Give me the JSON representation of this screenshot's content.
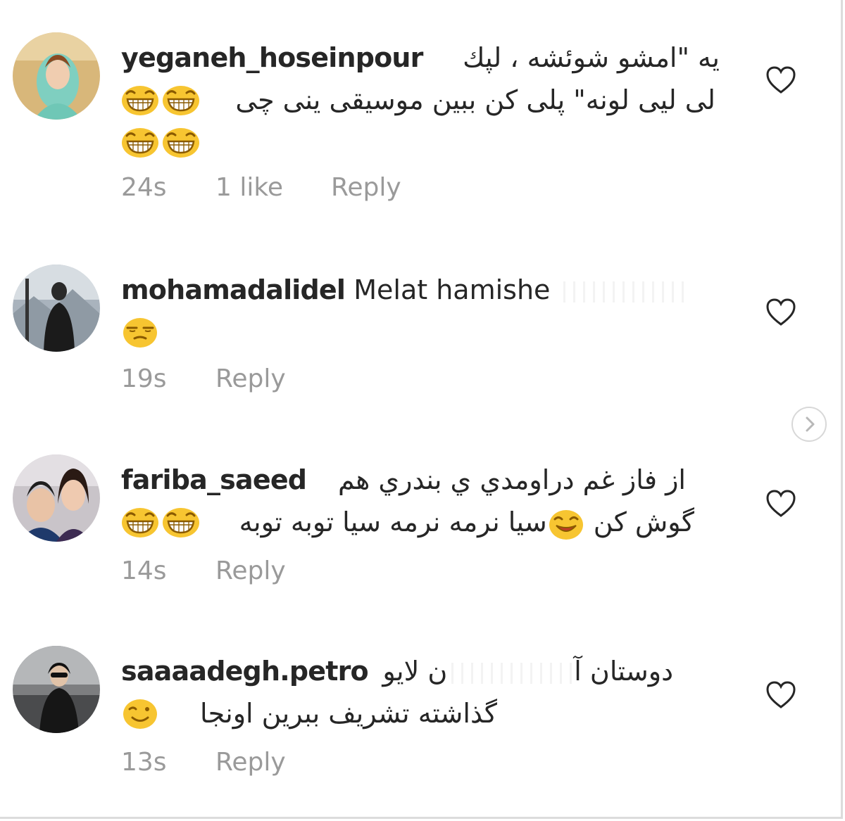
{
  "comments": [
    {
      "username": "yeganeh_hoseinpour",
      "line1_rtl": "يه \"امشو شوئشه ، لپك",
      "line2_rtl": "لی لیی لونه\" پلی کن ببین موسیقی ینی چی",
      "time": "24s",
      "likes": "1 like",
      "reply": "Reply",
      "emoji": "laughing-face"
    },
    {
      "username": "mohamadalidel",
      "text": "Melat hamishe",
      "time": "19s",
      "reply": "Reply",
      "emoji": "unamused-face"
    },
    {
      "username": "fariba_saeed",
      "line1_rtl": "از فاز غم دراومدي ي بندري هم",
      "line2_rtl_a": "گوش کن",
      "line2_rtl_b": "سیا نرمه نرمه سیا توبه توبه",
      "time": "14s",
      "reply": "Reply",
      "emoji": "laughing-face"
    },
    {
      "username": "saaaadegh.petro",
      "line1_rtl_a": "دوستان آ",
      "line1_rtl_b": "ن لایو",
      "line2_rtl": "گذاشته تشریف ببرین اونجا",
      "time": "13s",
      "reply": "Reply",
      "emoji": "smiling-face"
    }
  ],
  "icons": {
    "like": "heart-outline-icon",
    "next": "chevron-right-icon"
  },
  "colors": {
    "text": "#262626",
    "meta": "#9a9a9a",
    "emoji": "#f7c531"
  }
}
